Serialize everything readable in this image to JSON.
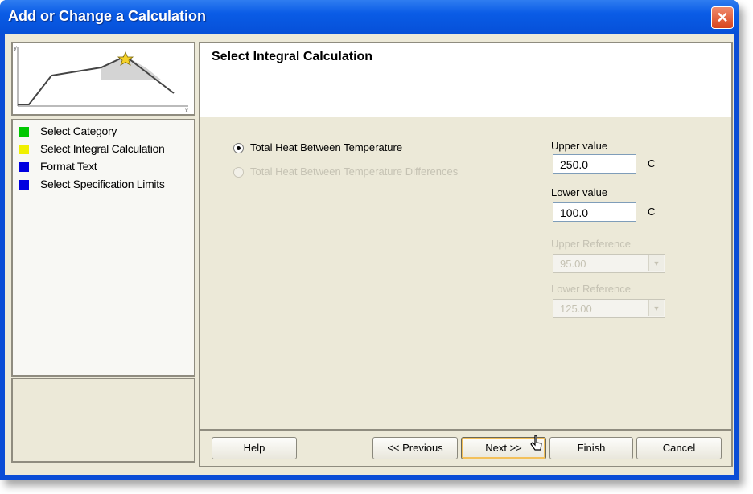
{
  "window": {
    "title": "Add or Change a Calculation",
    "close_glyph": "✕"
  },
  "preview_chart": {
    "axis_y_label": "y",
    "axis_x_label": "x",
    "star_icon": "star-icon"
  },
  "steps": [
    {
      "label": "Select Category",
      "color": "#00c800"
    },
    {
      "label": "Select Integral Calculation",
      "color": "#f0f000"
    },
    {
      "label": "Format Text",
      "color": "#0000e0"
    },
    {
      "label": "Select Specification Limits",
      "color": "#0000e0"
    }
  ],
  "main": {
    "heading": "Select Integral Calculation",
    "options": [
      {
        "label": "Total Heat Between Temperature",
        "checked": true,
        "enabled": true
      },
      {
        "label": "Total Heat Between Temperature Differences",
        "checked": false,
        "enabled": false
      }
    ],
    "upper": {
      "label": "Upper value",
      "value": "250.0",
      "unit": "C"
    },
    "lower": {
      "label": "Lower value",
      "value": "100.0",
      "unit": "C"
    },
    "combo1": {
      "label": "Upper Reference",
      "value": "95.00"
    },
    "combo2": {
      "label": "Lower Reference",
      "value": "125.00"
    }
  },
  "buttons": {
    "help": "Help",
    "previous": "<< Previous",
    "next": "Next >>",
    "finish": "Finish",
    "cancel": "Cancel"
  }
}
